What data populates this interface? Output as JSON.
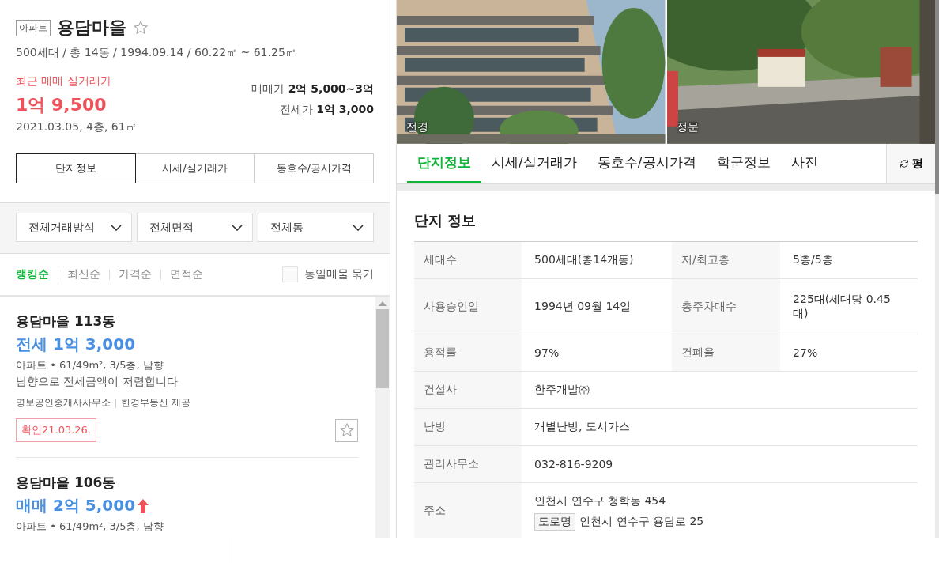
{
  "complex": {
    "type_badge": "아파트",
    "name": "용담마을",
    "favorite": false,
    "summary": "500세대 / 총 14동 / 1994.09.14 / 60.22㎡ ~ 61.25㎡"
  },
  "recent_trade": {
    "label": "최근 매매 실거래가",
    "price": "1억 9,500",
    "detail": "2021.03.05, 4층, 61㎡"
  },
  "asking_prices": [
    {
      "label": "매매가",
      "value": "2억 5,000~3억"
    },
    {
      "label": "전세가",
      "value": "1억 3,000"
    }
  ],
  "left_tabs": [
    {
      "label": "단지정보",
      "selected": true
    },
    {
      "label": "시세/실거래가",
      "selected": false
    },
    {
      "label": "동호수/공시가격",
      "selected": false
    }
  ],
  "filters": [
    "전체거래방식",
    "전체면적",
    "전체동"
  ],
  "sort_options": [
    {
      "label": "랭킹순",
      "selected": true
    },
    {
      "label": "최신순",
      "selected": false
    },
    {
      "label": "가격순",
      "selected": false
    },
    {
      "label": "면적순",
      "selected": false
    }
  ],
  "group_same": {
    "label": "동일매물 묶기",
    "checked": false
  },
  "listings": [
    {
      "title": "용담마을 113동",
      "price": "전세 1억 3,000",
      "price_up": false,
      "spec": "아파트 • 61/49m², 3/5층, 남향",
      "description": "남향으로 전세금액이 저렴합니다",
      "agency": "명보공인중개사사무소",
      "provider": "한경부동산 제공",
      "confirmed": "확인21.03.26.",
      "favorite": false
    },
    {
      "title": "용담마을 106동",
      "price": "매매 2억 5,000",
      "price_up": true,
      "spec": "아파트 • 61/49m², 3/5층, 남향"
    }
  ],
  "photos": [
    {
      "caption": "전경"
    },
    {
      "caption": "정문"
    }
  ],
  "right_tabs": [
    {
      "label": "단지정보",
      "selected": true
    },
    {
      "label": "시세/실거래가",
      "selected": false
    },
    {
      "label": "동호수/공시가격",
      "selected": false
    },
    {
      "label": "학군정보",
      "selected": false
    },
    {
      "label": "사진",
      "selected": false
    }
  ],
  "unit_toggle": {
    "label": "평"
  },
  "section_title": "단지 정보",
  "info_rows": [
    {
      "kind": "pair",
      "cells": [
        {
          "label": "세대수",
          "value": "500세대(총14개동)"
        },
        {
          "label": "저/최고층",
          "value": "5층/5층"
        }
      ]
    },
    {
      "kind": "pair",
      "cells": [
        {
          "label": "사용승인일",
          "value": "1994년 09월 14일"
        },
        {
          "label": "총주차대수",
          "value": "225대(세대당 0.45대)"
        }
      ]
    },
    {
      "kind": "pair",
      "cells": [
        {
          "label": "용적률",
          "value": "97%"
        },
        {
          "label": "건폐율",
          "value": "27%"
        }
      ]
    },
    {
      "kind": "single",
      "label": "건설사",
      "value": "한주개발㈜"
    },
    {
      "kind": "single",
      "label": "난방",
      "value": "개별난방, 도시가스"
    },
    {
      "kind": "single",
      "label": "관리사무소",
      "value": "032-816-9209"
    },
    {
      "kind": "address",
      "label": "주소",
      "value": "인천시 연수구 청학동 454",
      "road_badge": "도로명",
      "road_address": "인천시 연수구 용담로 25"
    }
  ]
}
